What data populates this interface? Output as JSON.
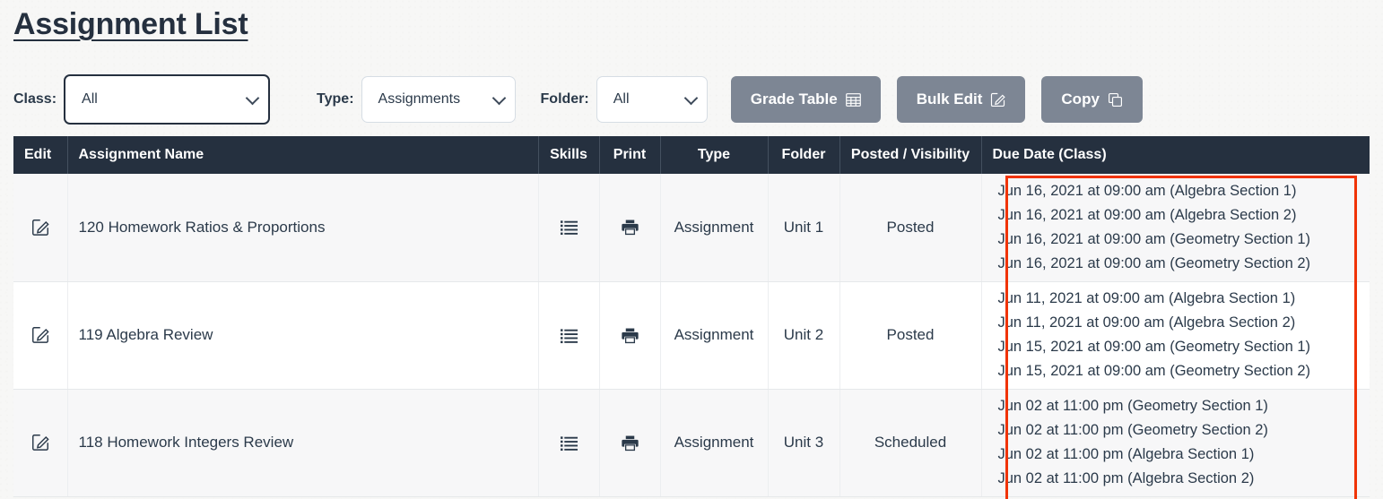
{
  "page": {
    "title": "Assignment List"
  },
  "filters": {
    "class": {
      "label": "Class:",
      "value": "All"
    },
    "type": {
      "label": "Type:",
      "value": "Assignments"
    },
    "folder": {
      "label": "Folder:",
      "value": "All"
    }
  },
  "actions": {
    "grade_table": {
      "label": "Grade Table",
      "icon": "table-grid-icon"
    },
    "bulk_edit": {
      "label": "Bulk Edit",
      "icon": "pencil-square-icon"
    },
    "copy": {
      "label": "Copy",
      "icon": "copy-icon"
    }
  },
  "table": {
    "headers": [
      "Edit",
      "Assignment Name",
      "Skills",
      "Print",
      "Type",
      "Folder",
      "Posted / Visibility",
      "Due Date (Class)"
    ],
    "rows": [
      {
        "edit_icon": "pencil-square-icon",
        "name": "120 Homework Ratios & Proportions",
        "skills_icon": "list-icon",
        "print_icon": "printer-icon",
        "type": "Assignment",
        "folder": "Unit 1",
        "posted": "Posted",
        "due_dates": [
          "Jun 16, 2021 at 09:00 am (Algebra Section 1)",
          "Jun 16, 2021 at 09:00 am (Algebra Section 2)",
          "Jun 16, 2021 at 09:00 am (Geometry Section 1)",
          "Jun 16, 2021 at 09:00 am (Geometry Section 2)"
        ]
      },
      {
        "edit_icon": "pencil-square-icon",
        "name": "119 Algebra Review",
        "skills_icon": "list-icon",
        "print_icon": "printer-icon",
        "type": "Assignment",
        "folder": "Unit 2",
        "posted": "Posted",
        "due_dates": [
          "Jun 11, 2021 at 09:00 am (Algebra Section 1)",
          "Jun 11, 2021 at 09:00 am (Algebra Section 2)",
          "Jun 15, 2021 at 09:00 am (Geometry Section 1)",
          "Jun 15, 2021 at 09:00 am (Geometry Section 2)"
        ]
      },
      {
        "edit_icon": "pencil-square-icon",
        "name": "118 Homework Integers Review",
        "skills_icon": "list-icon",
        "print_icon": "printer-icon",
        "type": "Assignment",
        "folder": "Unit 3",
        "posted": "Scheduled",
        "due_dates": [
          "Jun 02 at 11:00 pm (Geometry Section 1)",
          "Jun 02 at 11:00 pm (Geometry Section 2)",
          "Jun 02 at 11:00 pm (Algebra Section 1)",
          "Jun 02 at 11:00 pm (Algebra Section 2)"
        ]
      }
    ]
  },
  "annotation": {
    "highlight_color": "#f03305",
    "target_column": "Due Date (Class)"
  },
  "colors": {
    "header_bg": "#25303f",
    "button_bg": "#7d8694",
    "text": "#2b3a4a",
    "page_bg": "#f7f7f6"
  }
}
